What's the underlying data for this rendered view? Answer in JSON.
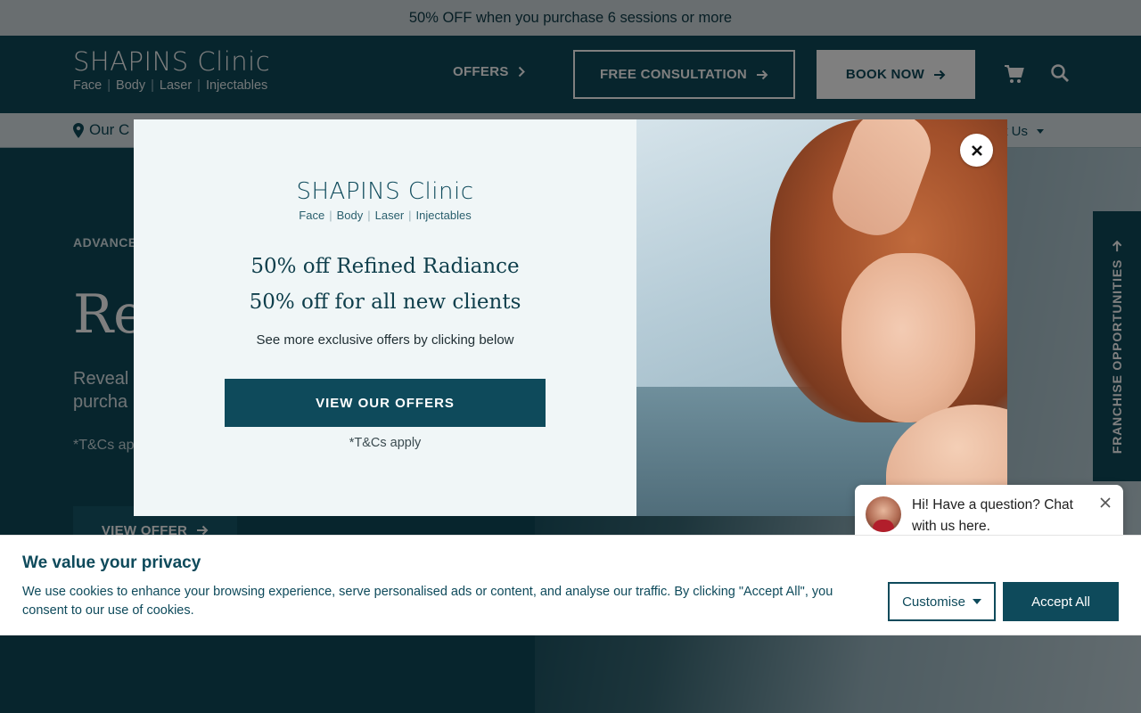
{
  "promo": {
    "text": "50% OFF when you purchase 6 sessions or more"
  },
  "header": {
    "logo_title": "SHAPINS Clinic",
    "logo_sub": [
      "Face",
      "Body",
      "Laser",
      "Injectables"
    ],
    "offers_label": "OFFERS",
    "consult_label": "FREE CONSULTATION",
    "book_label": "BOOK NOW",
    "icons": {
      "cart": "cart-icon",
      "search": "search-icon"
    }
  },
  "subnav": {
    "location_label": "Our C",
    "about_label": "ut Us"
  },
  "hero": {
    "tag": "ADVANCE",
    "title": "Re",
    "desc_line1": "Reveal",
    "desc_line2": "purcha",
    "tc": "*T&Cs ap",
    "cta": "VIEW OFFER"
  },
  "franchise": {
    "label": "FRANCHISE OPPORTUNITIES"
  },
  "modal": {
    "logo_title": "SHAPINS Clinic",
    "logo_sub": [
      "Face",
      "Body",
      "Laser",
      "Injectables"
    ],
    "heading1": "50% off Refined Radiance",
    "heading2": "50% off for all new clients",
    "text": "See more exclusive offers by clicking below",
    "button": "VIEW OUR OFFERS",
    "tc": "*T&Cs apply"
  },
  "chat": {
    "message": "Hi! Have a question? Chat with us here."
  },
  "cookie": {
    "title": "We value your privacy",
    "text": "We use cookies to enhance your browsing experience, serve personalised ads or content, and analyse our traffic. By clicking \"Accept All\", you consent to our use of cookies.",
    "customise_label": "Customise",
    "accept_label": "Accept All"
  },
  "colors": {
    "brand": "#0e4a5b",
    "promo_bg": "#d3dde0",
    "modal_bg": "#f0f6f7"
  }
}
